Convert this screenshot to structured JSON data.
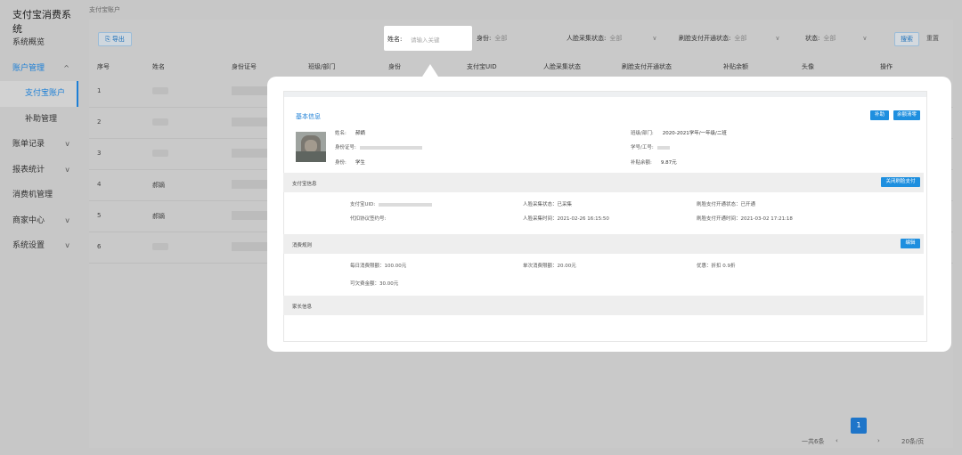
{
  "app_title": "支付宝消费系统",
  "breadcrumb": "支付宝账户",
  "sidebar": {
    "items": [
      {
        "label": "系统概览"
      },
      {
        "label": "账户管理",
        "chevron": "^"
      },
      {
        "label": "支付宝账户"
      },
      {
        "label": "补助管理"
      },
      {
        "label": "账单记录",
        "chevron": "v"
      },
      {
        "label": "报表统计",
        "chevron": "v"
      },
      {
        "label": "消费机管理"
      },
      {
        "label": "商家中心",
        "chevron": "v"
      },
      {
        "label": "系统设置",
        "chevron": "v"
      }
    ]
  },
  "toolbar": {
    "export_label": "导出",
    "identity_label": "身份:",
    "identity_value": "全部",
    "face_label": "人脸采集状态:",
    "face_value": "全部",
    "pay_label": "刷脸支付开通状态:",
    "pay_value": "全部",
    "status_label": "状态:",
    "status_value": "全部",
    "search_label": "搜索",
    "reset_label": "重置"
  },
  "search_popup": {
    "label": "姓名:",
    "placeholder": "请输入关键"
  },
  "table": {
    "columns": [
      "序号",
      "姓名",
      "身份证号",
      "班级/部门",
      "身份",
      "支付宝UID",
      "人脸采集状态",
      "刷脸支付开通状态",
      "补贴余额",
      "头像",
      "操作"
    ],
    "rows": [
      {
        "idx": "1",
        "name": ""
      },
      {
        "idx": "2",
        "name": ""
      },
      {
        "idx": "3",
        "name": ""
      },
      {
        "idx": "4",
        "name": "郝嫡"
      },
      {
        "idx": "5",
        "name": "郝嫡"
      },
      {
        "idx": "6",
        "name": ""
      }
    ]
  },
  "pager": {
    "total": "一共6条",
    "prev": "‹",
    "current": "1",
    "next": "›",
    "page_size": "20条/页"
  },
  "detail": {
    "basic_title": "基本信息",
    "btn_subsidy": "补助",
    "btn_recharge": "余额清零",
    "name_label": "姓名:",
    "name_value": "郝嫡",
    "id_label": "身份证号:",
    "identity_label": "身份:",
    "identity_value": "学生",
    "class_label": "班级/部门:",
    "class_value": "2020-2021学年/一年级/二班",
    "studentno_label": "学号/工号:",
    "balance_label": "补贴余额:",
    "balance_value": "9.87元",
    "alipay_section": "支付宝信息",
    "btn_close_face": "关闭刷脸支付",
    "uid_label": "支付宝UID:",
    "agreement_label": "代扣协议签约号:",
    "face_status": "人脸采集状态：已采集",
    "face_time": "人脸采集时间：2021-02-26 16:15:50",
    "pay_status": "刷脸支付开通状态：已开通",
    "pay_time": "刷脸支付开通时间：2021-03-02 17:21:18",
    "rule_section": "消费规则",
    "btn_edit": "编辑",
    "daily_limit": "每日消费限额：100.00元",
    "single_limit": "单次消费限额：20.00元",
    "discount": "优惠：折扣 0.9折",
    "overdraft": "可欠费金额：30.00元",
    "parent_section": "家长信息"
  }
}
